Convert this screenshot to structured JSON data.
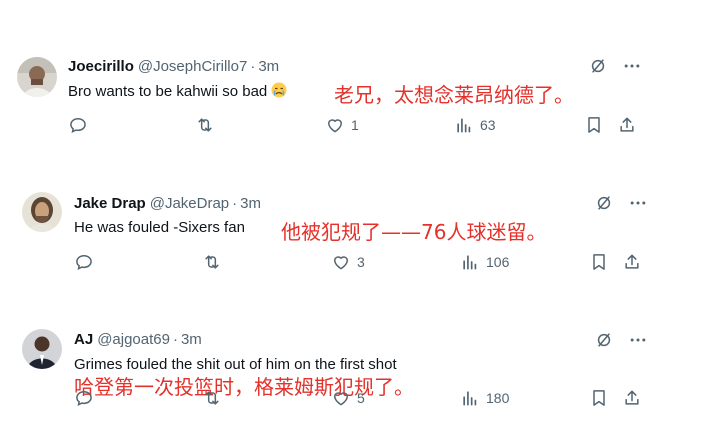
{
  "posts": [
    {
      "name": "Joecirillo",
      "handle": "@JosephCirillo7",
      "time": "3m",
      "text": "Bro wants to be kahwii so bad",
      "annotation": "老兄，太想念莱昂纳德了。",
      "likes": "1",
      "views": "63",
      "emoji": "crying-face"
    },
    {
      "name": "Jake Drap",
      "handle": "@JakeDrap",
      "time": "3m",
      "text": "He was fouled -Sixers fan",
      "annotation": "他被犯规了——76人球迷留。",
      "likes": "3",
      "views": "106"
    },
    {
      "name": "AJ",
      "handle": "@ajgoat69",
      "time": "3m",
      "text": "Grimes fouled the shit out of him on the first shot",
      "annotation": "哈登第一次投篮时，格莱姆斯犯规了。",
      "likes": "5",
      "views": "180"
    }
  ],
  "separator": "·",
  "colors": {
    "annotation": "#e4312b",
    "muted": "#536471",
    "text": "#0f1419"
  },
  "icons": [
    "reply-icon",
    "repost-icon",
    "like-icon",
    "views-icon",
    "bookmark-icon",
    "share-icon",
    "grok-icon",
    "more-icon"
  ]
}
